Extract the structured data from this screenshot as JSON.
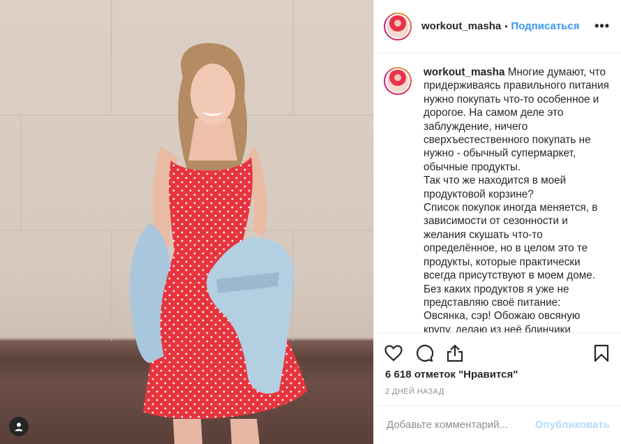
{
  "post": {
    "username": "workout_masha",
    "separator": "•",
    "follow_label": "Подписаться",
    "more_label": "•••",
    "caption_username": "workout_masha",
    "caption_text": "Многие думают, что придерживаясь правильного питания нужно покупать что-то особенное и дорогое. На самом деле это заблуждение, ничего сверхъестественного покупать не нужно - обычный супермаркет, обычные продукты.\nТак что же находится в моей продуктовой корзине?\nСписок покупок иногда меняется, в зависимости от сезонности и желания скушать что-то определённое, но в целом это те продукты, которые практически всегда присутствуют в моем доме.\nБез каких продуктов я уже не представляю своё питание:\nОвсянка, сэр! Обожаю овсяную крупу, делаю из неё блинчики",
    "likes": "6 618 отметок \"Нравится\"",
    "timestamp": "2 ДНЕЙ НАЗАД"
  },
  "comment": {
    "placeholder": "Добавьте комментарий...",
    "publish_label": "Опубликовать"
  },
  "icons": [
    "heart-icon",
    "comment-icon",
    "share-icon",
    "bookmark-icon",
    "user-tag-icon"
  ],
  "colors": {
    "link": "#3897f0",
    "publish_disabled": "#b3dbff",
    "muted": "#8e8e8e",
    "text": "#262626",
    "dress": "#e8343e"
  }
}
